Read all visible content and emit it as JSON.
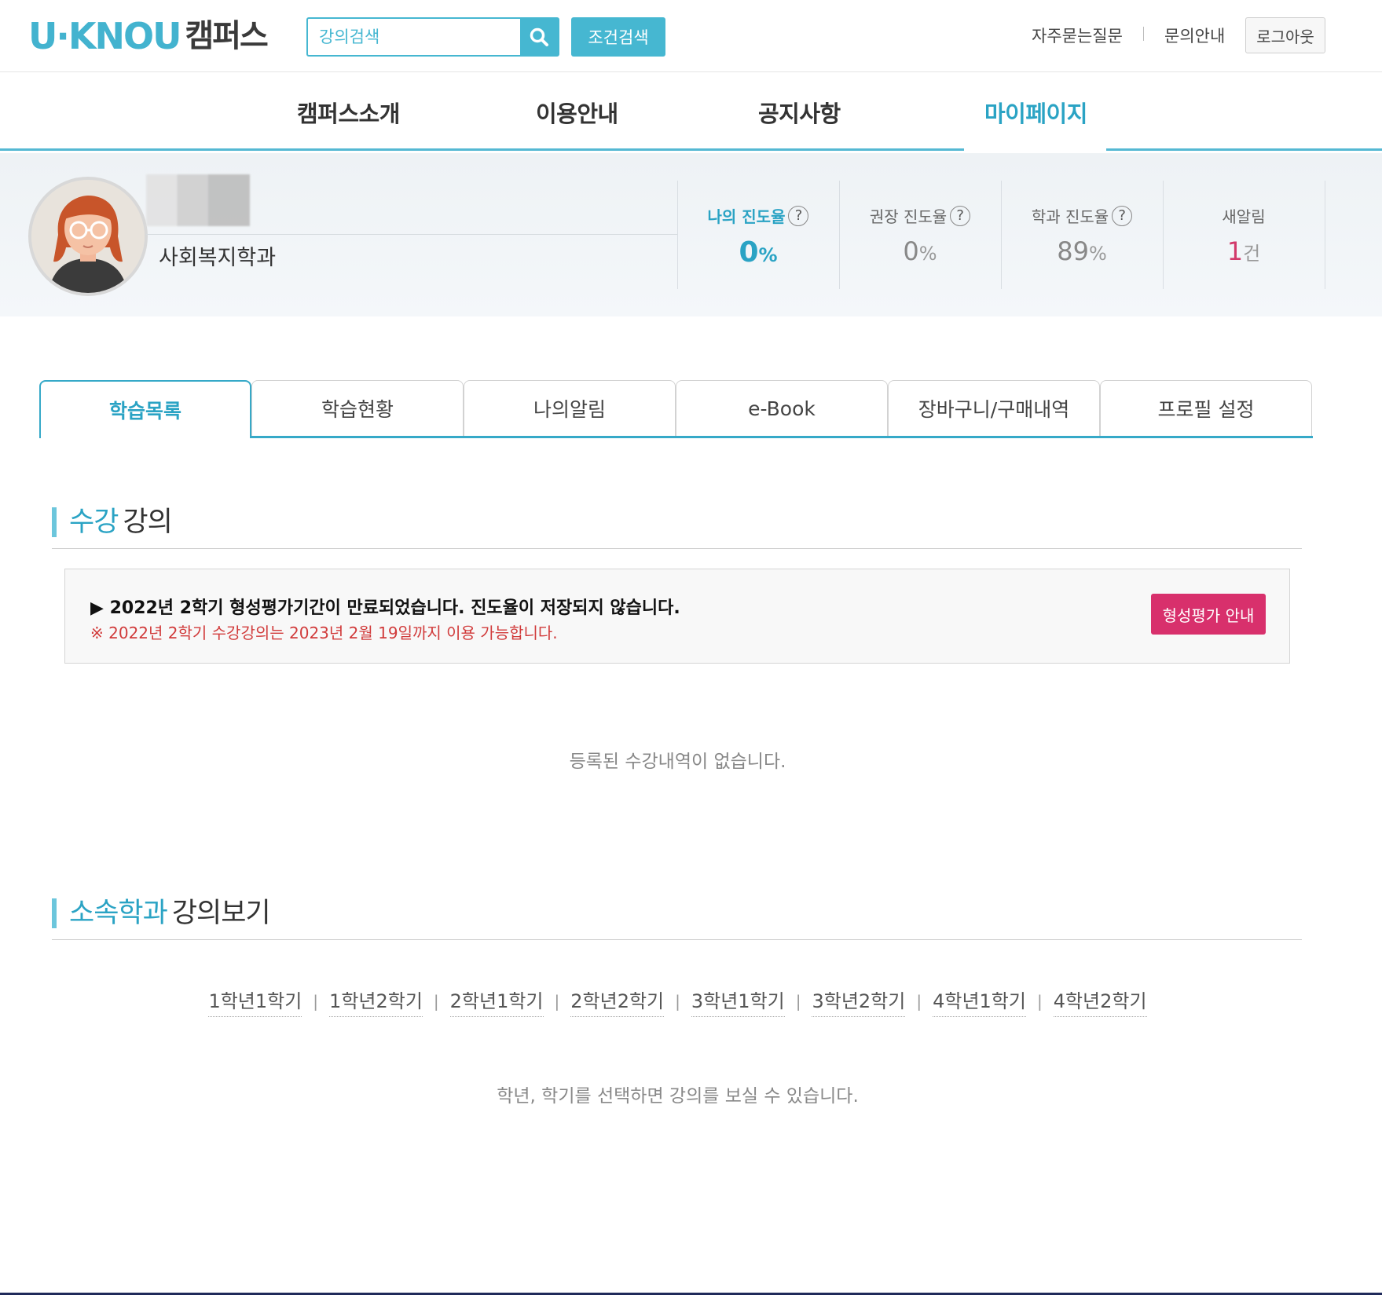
{
  "header": {
    "logo_text": "U·KNOU",
    "logo_campus": "캠퍼스",
    "search": {
      "placeholder": "강의검색",
      "value": ""
    },
    "condition_search_label": "조건검색",
    "util_links": [
      "자주묻는질문",
      "문의안내"
    ],
    "logout_label": "로그아웃"
  },
  "gnb": {
    "items": [
      "캠퍼스소개",
      "이용안내",
      "공지사항",
      "마이페이지"
    ],
    "active": "마이페이지"
  },
  "profile": {
    "department": "사회복지학과",
    "stats": [
      {
        "label": "나의 진도율",
        "value": "0",
        "unit": "%",
        "help": "?"
      },
      {
        "label": "권장 진도율",
        "value": "0",
        "unit": "%",
        "help": "?"
      },
      {
        "label": "학과 진도율",
        "value": "89",
        "unit": "%",
        "help": "?"
      },
      {
        "label": "새알림",
        "value": "1",
        "unit": "건"
      }
    ]
  },
  "tabs": [
    "학습목록",
    "학습현황",
    "나의알림",
    "e-Book",
    "장바구니/구매내역",
    "프로필 설정"
  ],
  "active_tab": "학습목록",
  "courses": {
    "title_highlight": "수강",
    "title_rest": "강의",
    "notice_main": "▶ 2022년 2학기 형성평가기간이 만료되었습니다. 진도율이 저장되지 않습니다.",
    "notice_sub": "※ 2022년 2학기 수강강의는 2023년 2월 19일까지 이용 가능합니다.",
    "notice_button": "형성평가 안내",
    "empty_text": "등록된 수강내역이 없습니다."
  },
  "dept_courses": {
    "title_highlight": "소속학과",
    "title_rest": "강의보기",
    "semesters": [
      "1학년1학기",
      "1학년2학기",
      "2학년1학기",
      "2학년2학기",
      "3학년1학기",
      "3학년2학기",
      "4학년1학기",
      "4학년2학기"
    ],
    "empty_text": "학년, 학기를 선택하면 강의를 보실 수 있습니다."
  },
  "colors": {
    "accent": "#46b7d1",
    "active_text": "#2aa3c4",
    "alert": "#d8306c"
  }
}
